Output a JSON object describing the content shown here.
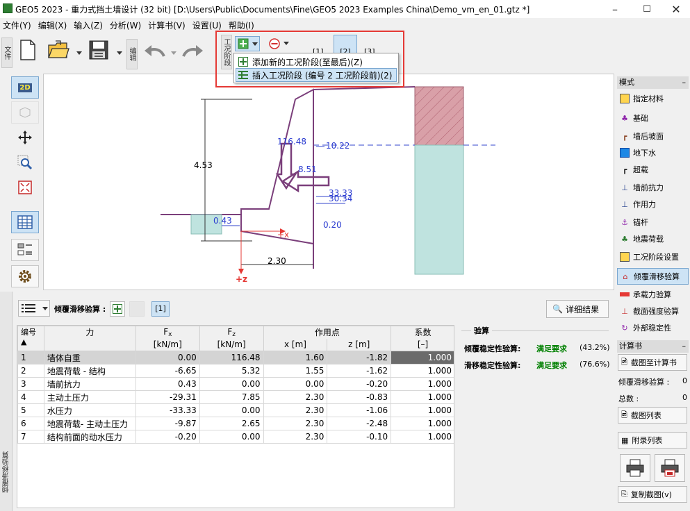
{
  "window": {
    "title": "GEO5 2023 - 重力式挡土墙设计 (32 bit) [D:\\Users\\Public\\Documents\\Fine\\GEO5 2023 Examples China\\Demo_vm_en_01.gtz *]",
    "min": "–",
    "max": "☐",
    "close": "✕"
  },
  "menu": [
    "文件(Y)",
    "编辑(X)",
    "输入(Z)",
    "分析(W)",
    "计算书(V)",
    "设置(U)",
    "帮助(I)"
  ],
  "toolbar": {
    "file_label": "文件",
    "edit_label": "编辑",
    "stage_label": "工况阶段",
    "stages": [
      "[1]",
      "[2]",
      "[3]"
    ]
  },
  "popup": {
    "items": [
      "添加新的工况阶段(至最后)(Z)",
      "插入工况阶段 (编号 2 工况阶段前)(2)"
    ]
  },
  "leftbar": {
    "mode_2d": "2D"
  },
  "canvas": {
    "dim_height": "4.53",
    "dim_width": "2.30",
    "axis_x": "+x",
    "axis_z": "+z",
    "labels": {
      "weight": "116.48",
      "water_top": "10.22",
      "h_force": "8.51",
      "active1": "33.33",
      "active2": "30.34",
      "front": "0.43",
      "bottom": "0.20"
    }
  },
  "bottom": {
    "section_label": "倾覆滑移验算 :",
    "stage_tab": "[1]",
    "detail_button": "详细结果",
    "side_title": "倾覆滑移验算",
    "table": {
      "headers": {
        "no": "编号 ▲",
        "force": "力",
        "fx": "F",
        "fx_sub": "x",
        "fz": "F",
        "fz_sub": "z",
        "point": "作用点",
        "coef": "系数",
        "fx_unit": "[kN/m]",
        "fz_unit": "[kN/m]",
        "x_unit": "x [m]",
        "z_unit": "z [m]",
        "coef_unit": "[–]"
      },
      "rows": [
        {
          "no": "1",
          "force": "墙体自重",
          "fx": "0.00",
          "fz": "116.48",
          "x": "1.60",
          "z": "-1.82",
          "coef": "1.000"
        },
        {
          "no": "2",
          "force": "地震荷载 - 结构",
          "fx": "-6.65",
          "fz": "5.32",
          "x": "1.55",
          "z": "-1.62",
          "coef": "1.000"
        },
        {
          "no": "3",
          "force": "墙前抗力",
          "fx": "0.43",
          "fz": "0.00",
          "x": "0.00",
          "z": "-0.20",
          "coef": "1.000"
        },
        {
          "no": "4",
          "force": "主动土压力",
          "fx": "-29.31",
          "fz": "7.85",
          "x": "2.30",
          "z": "-0.83",
          "coef": "1.000"
        },
        {
          "no": "5",
          "force": "水压力",
          "fx": "-33.33",
          "fz": "0.00",
          "x": "2.30",
          "z": "-1.06",
          "coef": "1.000"
        },
        {
          "no": "6",
          "force": "地震荷载- 主动土压力",
          "fx": "-9.87",
          "fz": "2.65",
          "x": "2.30",
          "z": "-2.48",
          "coef": "1.000"
        },
        {
          "no": "7",
          "force": "结构前面的动水压力",
          "fx": "-0.20",
          "fz": "0.00",
          "x": "2.30",
          "z": "-0.10",
          "coef": "1.000"
        }
      ]
    },
    "verify": {
      "title": "验算",
      "overturn_label": "倾覆稳定性验算:",
      "overturn_status": "满足要求",
      "overturn_pct": "(43.2%)",
      "slide_label": "滑移稳定性验算:",
      "slide_status": "满足要求",
      "slide_pct": "(76.6%)",
      "ok_color": "#008000"
    }
  },
  "rightpanel": {
    "mode_header": "模式",
    "modes": [
      {
        "label": "指定材料",
        "icon": "material-icon"
      },
      {
        "label": "基础",
        "icon": "foundation-icon"
      },
      {
        "label": "墙后坡面",
        "icon": "slope-icon"
      },
      {
        "label": "地下水",
        "icon": "water-icon"
      },
      {
        "label": "超载",
        "icon": "surcharge-icon"
      },
      {
        "label": "墙前抗力",
        "icon": "resistance-icon"
      },
      {
        "label": "作用力",
        "icon": "force-icon"
      },
      {
        "label": "锚杆",
        "icon": "anchor-icon"
      },
      {
        "label": "地震荷载",
        "icon": "earthquake-icon"
      },
      {
        "label": "工况阶段设置",
        "icon": "stage-settings-icon"
      },
      {
        "label": "倾覆滑移验算",
        "icon": "verification-icon"
      },
      {
        "label": "承载力验算",
        "icon": "bearing-icon"
      },
      {
        "label": "截面强度验算",
        "icon": "section-icon"
      },
      {
        "label": "外部稳定性",
        "icon": "stability-icon"
      }
    ],
    "report_header": "计算书",
    "add_report": "截图至计算书",
    "overturn_count_label": "倾覆滑移验算 :",
    "overturn_count": "0",
    "total_label": "总数 :",
    "total_count": "0",
    "pic_list": "截图列表",
    "appendix_list": "附录列表",
    "copy_pic": "复制截图(v)"
  }
}
